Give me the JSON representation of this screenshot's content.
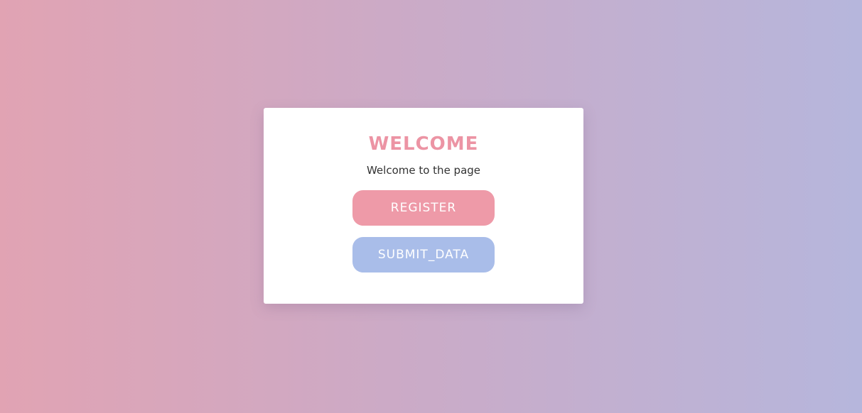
{
  "card": {
    "title": "WELCOME",
    "subtitle": "Welcome to the page",
    "register_label": "REGISTER",
    "submit_label": "SUBMIT_DATA"
  },
  "colors": {
    "title": "#ec94a4",
    "register_button": "#ee9aa8",
    "submit_button": "#a9bde9",
    "background_left": "#e1a3b3",
    "background_right": "#b6b6dc"
  }
}
